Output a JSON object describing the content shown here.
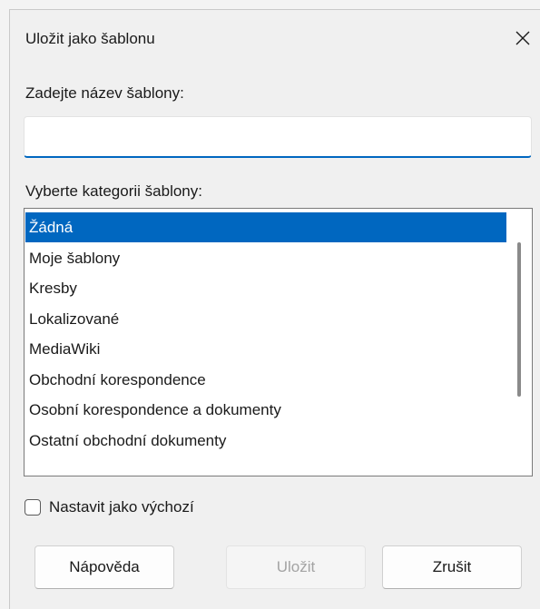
{
  "window": {
    "title": "Uložit jako šablonu",
    "close_icon": "close-icon"
  },
  "name_field": {
    "label": "Zadejte název šablony:",
    "value": ""
  },
  "category": {
    "label": "Vyberte kategorii šablony:",
    "items": [
      {
        "label": "Žádná",
        "selected": true
      },
      {
        "label": "Moje šablony",
        "selected": false
      },
      {
        "label": "Kresby",
        "selected": false
      },
      {
        "label": "Lokalizované",
        "selected": false
      },
      {
        "label": "MediaWiki",
        "selected": false
      },
      {
        "label": "Obchodní korespondence",
        "selected": false
      },
      {
        "label": "Osobní korespondence a dokumenty",
        "selected": false
      },
      {
        "label": "Ostatní obchodní dokumenty",
        "selected": false
      }
    ]
  },
  "default_checkbox": {
    "label": "Nastavit jako výchozí",
    "checked": false
  },
  "buttons": {
    "help": "Nápověda",
    "save": "Uložit",
    "save_enabled": false,
    "cancel": "Zrušit"
  },
  "colors": {
    "accent": "#0067c0",
    "dialog_bg": "#f0f0f0"
  }
}
